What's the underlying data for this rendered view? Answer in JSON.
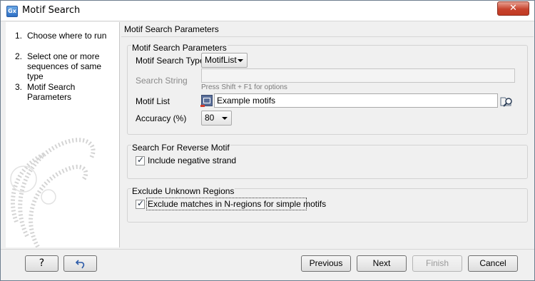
{
  "window": {
    "app_icon": "Gx",
    "title": "Motif Search",
    "close_glyph": "✕"
  },
  "steps": [
    {
      "num": "1.",
      "label": "Choose where to run"
    },
    {
      "num": "2.",
      "label": "Select one or more sequences of same type"
    },
    {
      "num": "3.",
      "label": "Motif Search Parameters"
    }
  ],
  "content_header": "Motif Search Parameters",
  "motif_params": {
    "group_title": "Motif Search Parameters",
    "type_label": "Motif Search Type",
    "type_value": "MotifList",
    "search_string_label": "Search String",
    "search_string_value": "",
    "search_hint": "Press Shift + F1 for options",
    "motif_list_label": "Motif List",
    "motif_list_value": "Example motifs",
    "accuracy_label": "Accuracy (%)",
    "accuracy_value": "80"
  },
  "reverse": {
    "group_title": "Search For Reverse Motif",
    "checkbox_label": "Include negative strand",
    "checked": true
  },
  "unknown": {
    "group_title": "Exclude Unknown Regions",
    "checkbox_label": "Exclude matches in N-regions for simple motifs",
    "checked": true
  },
  "buttons": {
    "help": "?",
    "reset_icon": "reset-arrow-icon",
    "previous": "Previous",
    "next": "Next",
    "finish": "Finish",
    "cancel": "Cancel"
  },
  "colors": {
    "accent": "#2e6fc4",
    "close": "#c7432d"
  }
}
